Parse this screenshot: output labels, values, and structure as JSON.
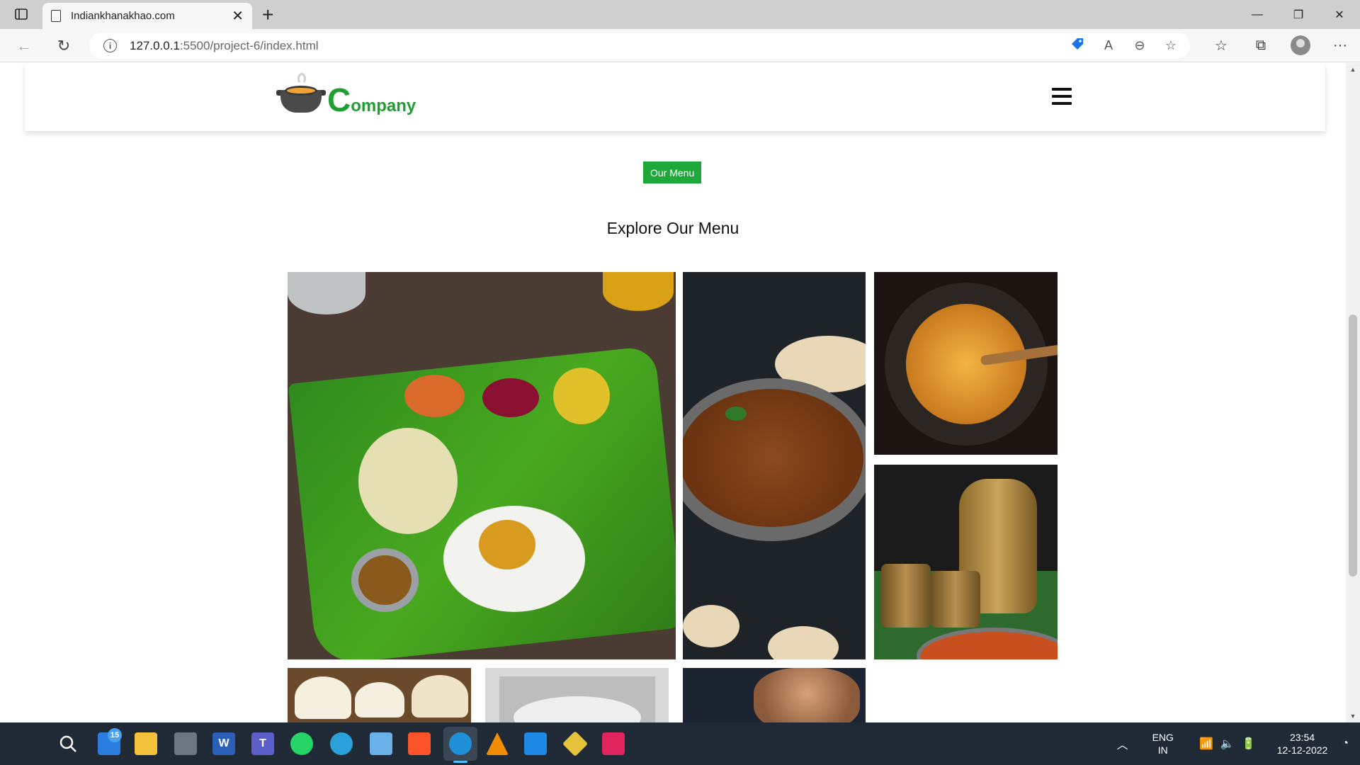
{
  "browser": {
    "tab_title": "Indiankhanakhao.com",
    "tab_close": "✕",
    "new_tab": "+",
    "url_host": "127.0.0.1",
    "url_rest": ":5500/project-6/index.html",
    "window": {
      "minimize": "—",
      "restore": "❐",
      "close": "✕"
    },
    "nav": {
      "back": "←",
      "reload": "↻",
      "info": "i"
    },
    "omni_icons": [
      "tag-icon",
      "read-aloud-icon",
      "zoom-out-icon",
      "add-favorite-icon"
    ],
    "toolbar": {
      "favorites": "☆",
      "collections": "⧉",
      "menu": "···"
    }
  },
  "site": {
    "logo_big": "C",
    "logo_small": "ompany",
    "badge": "Our Menu",
    "heading": "Explore Our Menu"
  },
  "gallery": {
    "items": [
      "thali-on-banana-leaf",
      "meat-curry-pan",
      "potato-sabzi-bowl",
      "brass-jugs-and-curry",
      "cupcakes",
      "white-plate",
      "chef"
    ]
  },
  "taskbar": {
    "notification_count": "15",
    "apps": [
      "search",
      "widgets",
      "file-explorer",
      "calculator",
      "word",
      "teams",
      "whatsapp",
      "telegram",
      "notepad",
      "brave",
      "edge",
      "vlc",
      "vscode",
      "git",
      "brave-nightly"
    ],
    "lang_line1": "ENG",
    "lang_line2": "IN",
    "time": "23:54",
    "date": "12-12-2022"
  },
  "colors": {
    "brand_green": "#1f9e32",
    "badge_green": "#1fa83a",
    "taskbar": "#1f2a36",
    "accent_blue": "#4cc2ff"
  }
}
